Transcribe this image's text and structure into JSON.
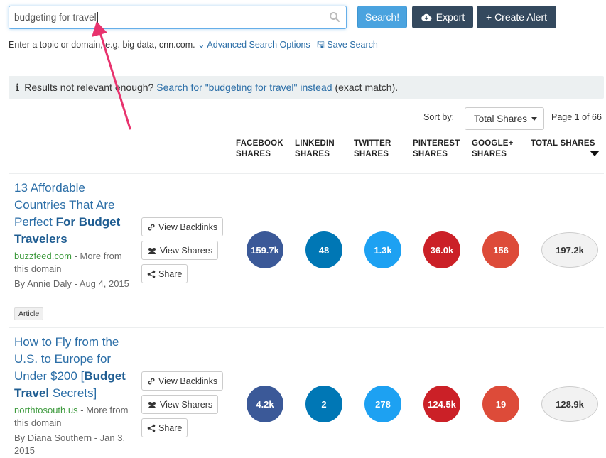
{
  "search": {
    "value": "budgeting for travel",
    "button_label": "Search!",
    "export_label": "Export",
    "create_alert_label": "+ Create Alert"
  },
  "hint": {
    "text": "Enter a topic or domain, e.g. big data, cnn.com.",
    "advanced_label": "Advanced Search Options",
    "save_label": "Save Search"
  },
  "notice": {
    "prefix": "Results not relevant enough?",
    "link": "Search for \"budgeting for travel\" instead",
    "suffix": "(exact match)."
  },
  "sort": {
    "label": "Sort by:",
    "selected": "Total Shares",
    "page_info": "Page 1 of 66"
  },
  "columns": {
    "facebook": [
      "FACEBOOK",
      "SHARES"
    ],
    "linkedin": [
      "LINKEDIN",
      "SHARES"
    ],
    "twitter": [
      "TWITTER",
      "SHARES"
    ],
    "pinterest": [
      "PINTEREST",
      "SHARES"
    ],
    "googleplus": [
      "GOOGLE+",
      "SHARES"
    ],
    "total": "TOTAL SHARES"
  },
  "actions": {
    "backlinks": "View Backlinks",
    "sharers": "View Sharers",
    "share": "Share"
  },
  "results": [
    {
      "title_plain": "13 Affordable Countries That Are Perfect ",
      "title_bold": "For Budget Travelers",
      "title_tail": "",
      "domain": "buzzfeed.com",
      "more": " - More from this domain",
      "byline": "By Annie Daly - Aug 4, 2015",
      "tag": "Article",
      "facebook": "159.7k",
      "linkedin": "48",
      "twitter": "1.3k",
      "pinterest": "36.0k",
      "googleplus": "156",
      "total": "197.2k"
    },
    {
      "title_plain": "How to Fly from the U.S. to Europe for Under $200 [",
      "title_bold": "Budget Travel",
      "title_tail": " Secrets]",
      "domain": "northtosouth.us",
      "more": " - More from this domain",
      "byline": "By Diana Southern - Jan 3, 2015",
      "tag": "",
      "facebook": "4.2k",
      "linkedin": "2",
      "twitter": "278",
      "pinterest": "124.5k",
      "googleplus": "19",
      "total": "128.9k"
    }
  ],
  "colors": {
    "primary": "#4aa3df",
    "dark": "#34495e",
    "facebook": "#3b5998",
    "linkedin": "#0077b5",
    "twitter": "#1da1f2",
    "pinterest": "#cb2027",
    "googleplus": "#dd4b39",
    "annotation": "#e8336e"
  }
}
